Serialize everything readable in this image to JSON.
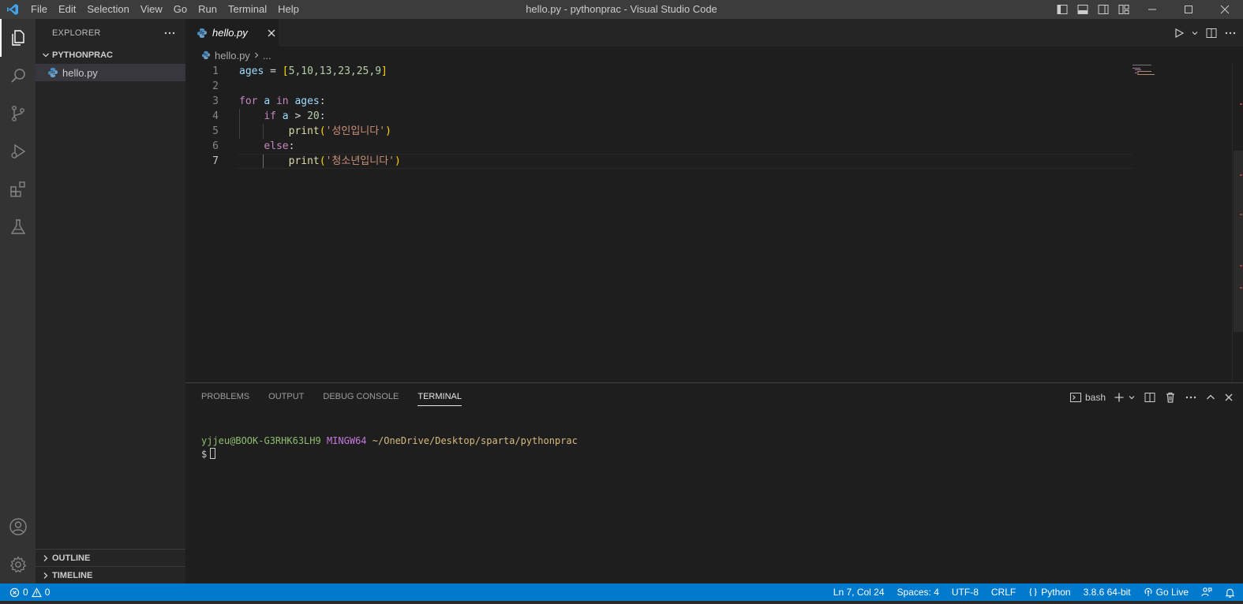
{
  "window": {
    "title": "hello.py - pythonprac - Visual Studio Code",
    "menu": [
      "File",
      "Edit",
      "Selection",
      "View",
      "Go",
      "Run",
      "Terminal",
      "Help"
    ]
  },
  "sidebar": {
    "header": "EXPLORER",
    "folder": "PYTHONPRAC",
    "files": [
      {
        "name": "hello.py",
        "icon": "python-file-icon"
      }
    ],
    "outline": "OUTLINE",
    "timeline": "TIMELINE"
  },
  "editor": {
    "tab": "hello.py",
    "breadcrumb": {
      "file": "hello.py",
      "more": "..."
    },
    "lines": [
      {
        "num": "1"
      },
      {
        "num": "2"
      },
      {
        "num": "3"
      },
      {
        "num": "4"
      },
      {
        "num": "5"
      },
      {
        "num": "6"
      },
      {
        "num": "7"
      }
    ],
    "code": {
      "l1": {
        "var": "ages",
        "op": " = ",
        "open": "[",
        "values": "5,10,13,23,25,9",
        "close": "]"
      },
      "l3": {
        "kw1": "for",
        "v1": "a",
        "kw2": "in",
        "v2": "ages",
        "colon": ":"
      },
      "l4": {
        "kw": "if",
        "v": "a",
        "op": " > ",
        "num": "20",
        "colon": ":"
      },
      "l5": {
        "fn": "print",
        "open": "(",
        "str": "'성인입니다'",
        "close": ")"
      },
      "l6": {
        "kw": "else",
        "colon": ":"
      },
      "l7": {
        "fn": "print",
        "open": "(",
        "str": "'청소년입니다'",
        "close": ")"
      }
    }
  },
  "panel": {
    "tabs": [
      "PROBLEMS",
      "OUTPUT",
      "DEBUG CONSOLE",
      "TERMINAL"
    ],
    "active_tab": "TERMINAL",
    "terminal_name": "bash",
    "prompt": {
      "user": "yjjeu@BOOK-G3RHK63LH9",
      "env": "MINGW64",
      "path": "~/OneDrive/Desktop/sparta/pythonprac",
      "symbol": "$"
    }
  },
  "statusbar": {
    "errors": "0",
    "warnings": "0",
    "position": "Ln 7, Col 24",
    "spaces": "Spaces: 4",
    "encoding": "UTF-8",
    "eol": "CRLF",
    "language": "Python",
    "interpreter": "3.8.6 64-bit",
    "golive": "Go Live"
  },
  "colors": {
    "statusbar": "#007acc",
    "activitybar": "#333333",
    "sidebar": "#252526",
    "editor": "#1e1e1e",
    "keyword": "#c586c0",
    "string": "#ce9178",
    "function": "#dcdcaa"
  }
}
